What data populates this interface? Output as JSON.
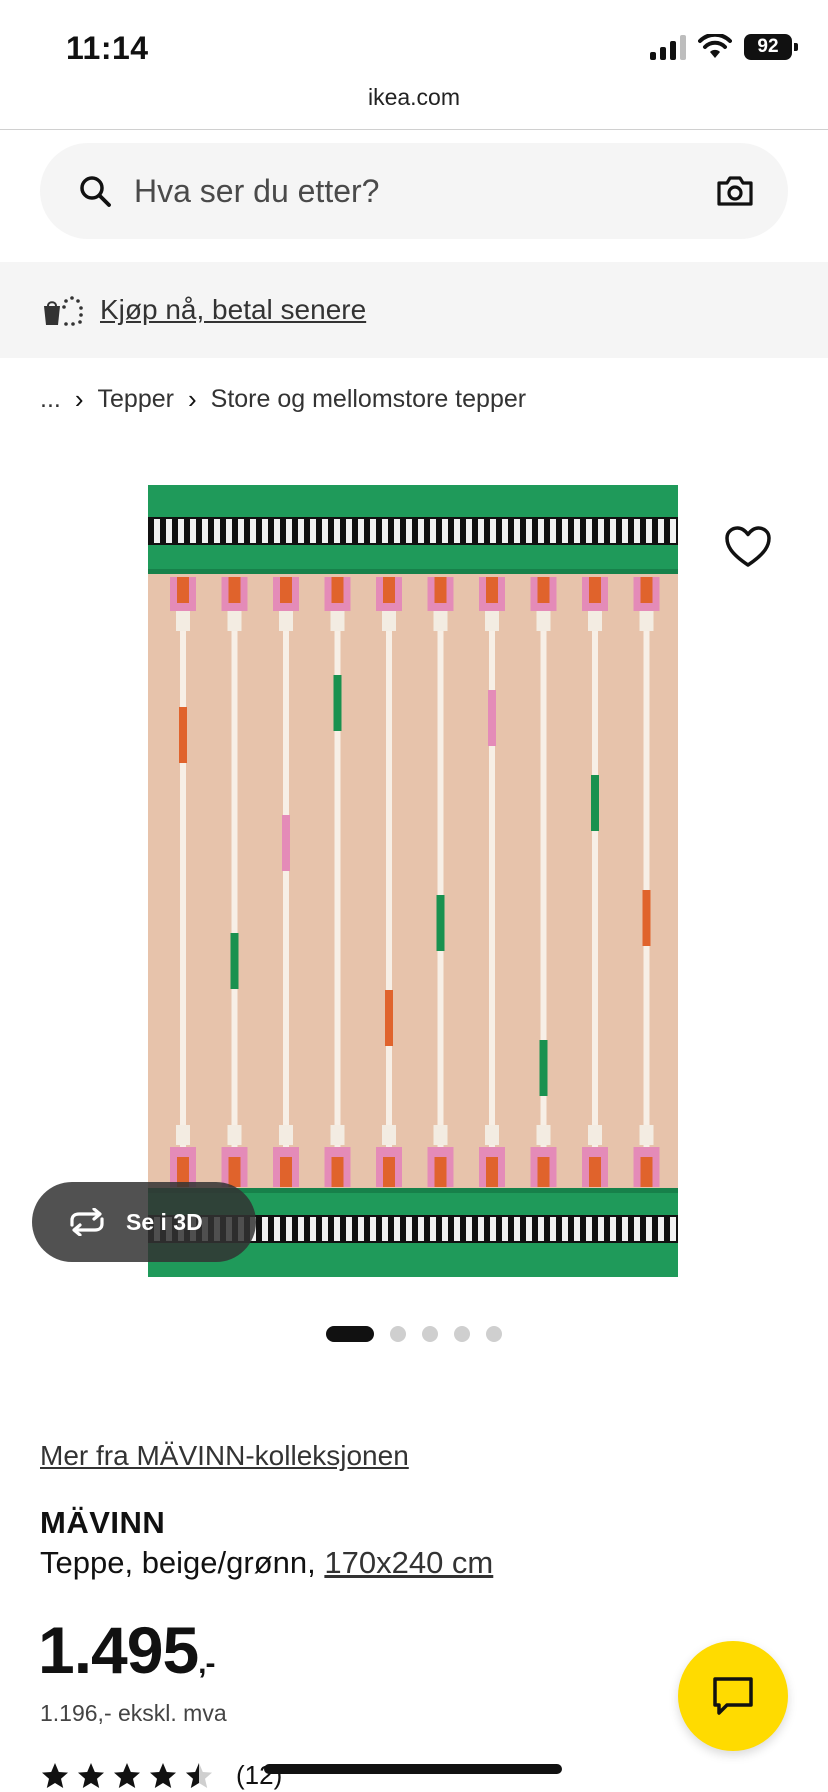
{
  "status_bar": {
    "time": "11:14",
    "battery": "92"
  },
  "browser": {
    "url": "ikea.com"
  },
  "search": {
    "placeholder": "Hva ser du etter?"
  },
  "promo": {
    "label": "Kjøp nå, betal senere"
  },
  "breadcrumb": {
    "items": [
      "...",
      "Tepper",
      "Store og mellomstore tepper"
    ]
  },
  "media": {
    "view_3d_label": "Se i 3D",
    "image_count": 5,
    "active_index": 0
  },
  "product": {
    "collection_link": "Mer fra MÄVINN-kolleksjonen",
    "name": "MÄVINN",
    "description": "Teppe, beige/grønn,",
    "size": "170x240 cm",
    "price_main": "1.495",
    "price_suffix": ",-",
    "price_ex_vat": "1.196,- ekskl. mva",
    "rating": 4.5,
    "review_count": "(12)"
  },
  "colors": {
    "accent_yellow": "#ffdb00",
    "rug_green": "#1f9a5a",
    "rug_beige": "#e7c3ab"
  }
}
